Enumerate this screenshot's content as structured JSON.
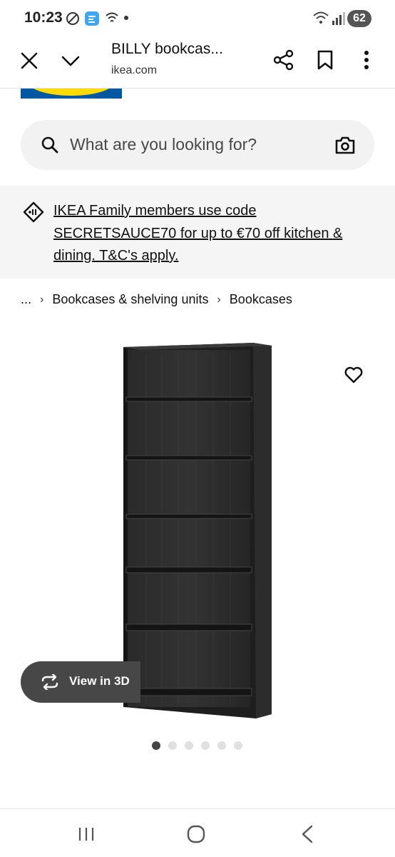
{
  "status_bar": {
    "time": "10:23",
    "battery": "62"
  },
  "browser": {
    "title": "BILLY bookcas...",
    "domain": "ikea.com"
  },
  "search": {
    "placeholder": "What are you looking for?"
  },
  "promo": {
    "text": "IKEA Family members use code SECRETSAUCE70 for up to €70 off kitchen & dining. T&C's apply."
  },
  "breadcrumb": {
    "ellipsis": "...",
    "items": [
      "Bookcases & shelving units",
      "Bookcases"
    ]
  },
  "product": {
    "view_3d_label": "View in 3D",
    "image_count": 6,
    "active_image": 1
  },
  "colors": {
    "brand_blue": "#0058a3",
    "brand_yellow": "#ffdb00",
    "button_dark": "#474747"
  }
}
